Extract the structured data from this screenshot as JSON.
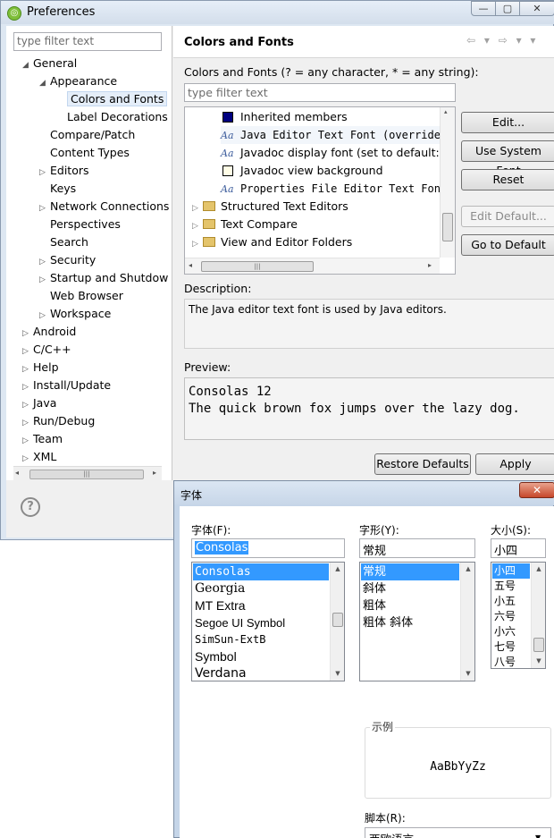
{
  "preferences": {
    "title": "Preferences",
    "window_buttons": {
      "minimize": "—",
      "maximize": "▢",
      "close": "✕"
    },
    "left": {
      "filter_placeholder": "type filter text",
      "tree": [
        {
          "label": "General",
          "arrow": "◢",
          "indent": 0
        },
        {
          "label": "Appearance",
          "arrow": "◢",
          "indent": 1
        },
        {
          "label": "Colors and Fonts",
          "arrow": "",
          "indent": 2,
          "selected": true
        },
        {
          "label": "Label Decorations",
          "arrow": "",
          "indent": 2
        },
        {
          "label": "Compare/Patch",
          "arrow": "",
          "indent": 1
        },
        {
          "label": "Content Types",
          "arrow": "",
          "indent": 1
        },
        {
          "label": "Editors",
          "arrow": "▷",
          "indent": 1
        },
        {
          "label": "Keys",
          "arrow": "",
          "indent": 1
        },
        {
          "label": "Network Connections",
          "arrow": "▷",
          "indent": 1
        },
        {
          "label": "Perspectives",
          "arrow": "",
          "indent": 1
        },
        {
          "label": "Search",
          "arrow": "",
          "indent": 1
        },
        {
          "label": "Security",
          "arrow": "▷",
          "indent": 1
        },
        {
          "label": "Startup and Shutdow",
          "arrow": "▷",
          "indent": 1
        },
        {
          "label": "Web Browser",
          "arrow": "",
          "indent": 1
        },
        {
          "label": "Workspace",
          "arrow": "▷",
          "indent": 1
        },
        {
          "label": "Android",
          "arrow": "▷",
          "indent": 0
        },
        {
          "label": "C/C++",
          "arrow": "▷",
          "indent": 0
        },
        {
          "label": "Help",
          "arrow": "▷",
          "indent": 0
        },
        {
          "label": "Install/Update",
          "arrow": "▷",
          "indent": 0
        },
        {
          "label": "Java",
          "arrow": "▷",
          "indent": 0
        },
        {
          "label": "Run/Debug",
          "arrow": "▷",
          "indent": 0
        },
        {
          "label": "Team",
          "arrow": "▷",
          "indent": 0
        },
        {
          "label": "XML",
          "arrow": "▷",
          "indent": 0
        }
      ],
      "help_icon": "?"
    },
    "right": {
      "page_title": "Colors and Fonts",
      "nav": "⇦ ▾ ⇨ ▾ ▾",
      "filter_hint": "Colors and Fonts (? = any character, * = any string):",
      "filter_placeholder": "type filter text",
      "font_tree": [
        {
          "label": "Inherited members",
          "icon": "color-blue",
          "mono": false
        },
        {
          "label": "Java Editor Text Font (overrides",
          "icon": "font",
          "mono": true,
          "selected": true
        },
        {
          "label": "Javadoc display font (set to default: D",
          "icon": "font",
          "mono": false
        },
        {
          "label": "Javadoc view background",
          "icon": "color-light",
          "mono": false
        },
        {
          "label": "Properties File Editor Text Font",
          "icon": "font",
          "mono": true
        },
        {
          "label": "Structured Text Editors",
          "icon": "folder",
          "mono": false
        },
        {
          "label": "Text Compare",
          "icon": "folder",
          "mono": false
        },
        {
          "label": "View and Editor Folders",
          "icon": "folder",
          "mono": false
        }
      ],
      "font_icon_text": "Aa",
      "buttons": {
        "edit": "Edit...",
        "use_system_font": "Use System Font",
        "reset": "Reset",
        "edit_default": "Edit Default...",
        "go_to_default": "Go to Default"
      },
      "description_label": "Description:",
      "description": "The Java editor text font is used by Java editors.",
      "preview_label": "Preview:",
      "preview_lines": [
        "Consolas 12",
        "The quick brown fox jumps over the lazy dog."
      ],
      "restore_defaults": "Restore Defaults",
      "apply": "Apply"
    }
  },
  "font_dialog": {
    "title": "字体",
    "close": "✕",
    "font_label": "字体(F):",
    "font_value": "Consolas",
    "fonts": [
      "Consolas",
      "Georgia",
      "MT Extra",
      "Segoe UI Symbol",
      "SimSun-ExtB",
      "Symbol",
      "Verdana"
    ],
    "style_label": "字形(Y):",
    "style_value": "常规",
    "styles": [
      "常规",
      "斜体",
      "粗体",
      "粗体 斜体"
    ],
    "size_label": "大小(S):",
    "size_value": "小四",
    "sizes": [
      "小四",
      "五号",
      "小五",
      "六号",
      "小六",
      "七号",
      "八号"
    ],
    "sample_label": "示例",
    "sample_text": "AaBbYyZz",
    "script_label": "脚本(R):",
    "script_value": "西欧语言"
  }
}
